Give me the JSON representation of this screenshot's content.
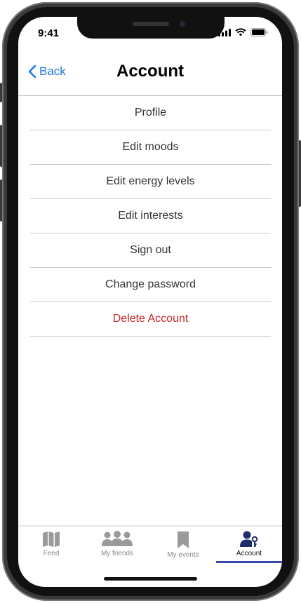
{
  "status_bar": {
    "time": "9:41"
  },
  "header": {
    "back_label": "Back",
    "title": "Account"
  },
  "menu": {
    "items": [
      {
        "label": "Profile"
      },
      {
        "label": "Edit moods"
      },
      {
        "label": "Edit energy levels"
      },
      {
        "label": "Edit interests"
      },
      {
        "label": "Sign out"
      },
      {
        "label": "Change password"
      },
      {
        "label": "Delete Account"
      }
    ]
  },
  "tabbar": {
    "tabs": [
      {
        "label": "Feed",
        "icon": "map-icon"
      },
      {
        "label": "My friends",
        "icon": "people-icon"
      },
      {
        "label": "My events",
        "icon": "bookmark-icon"
      },
      {
        "label": "Account",
        "icon": "user-key-icon"
      }
    ],
    "active_index": 3
  },
  "colors": {
    "accent": "#1a7ae6",
    "danger": "#c62828",
    "active_tab": "#3b4aa8"
  }
}
